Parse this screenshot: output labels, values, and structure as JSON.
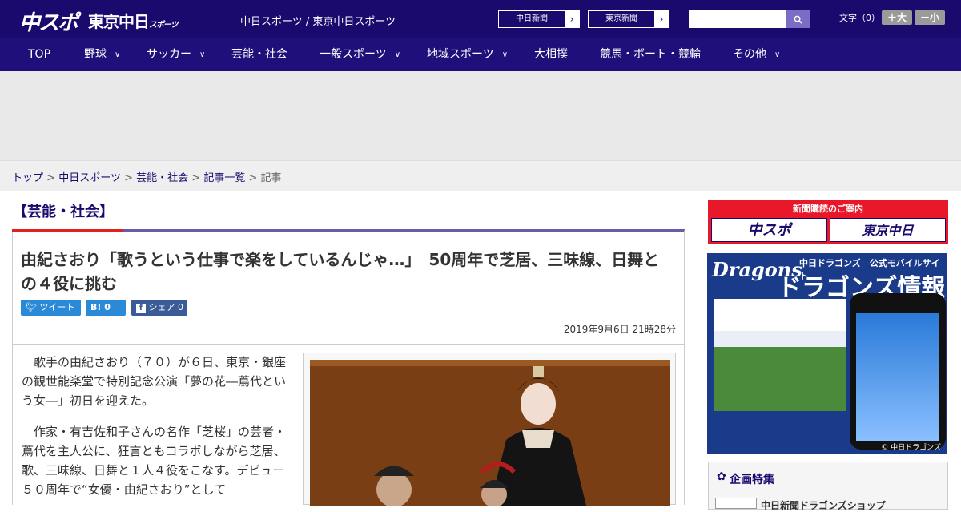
{
  "header": {
    "logo_chuspo": "中スポ",
    "logo_tokyo": "東京中日",
    "logo_tokyo_sub": "スポーツ",
    "site_links": "中日スポーツ / 東京中日スポーツ",
    "btn_chunichi": "中日新聞",
    "btn_tokyo": "東京新聞",
    "search_placeholder": "",
    "fontsize_label": "文字（0）",
    "fs_large": "＋大",
    "fs_small": "－小"
  },
  "nav": [
    {
      "label": "TOP",
      "dropdown": false
    },
    {
      "label": "野球",
      "dropdown": true
    },
    {
      "label": "サッカー",
      "dropdown": true
    },
    {
      "label": "芸能・社会",
      "dropdown": false
    },
    {
      "label": "一般スポーツ",
      "dropdown": true
    },
    {
      "label": "地域スポーツ",
      "dropdown": true
    },
    {
      "label": "大相撲",
      "dropdown": false
    },
    {
      "label": "競馬・ボート・競輪",
      "dropdown": false
    },
    {
      "label": "その他",
      "dropdown": true
    }
  ],
  "breadcrumbs": {
    "home": "トップ",
    "site": "中日スポーツ",
    "category": "芸能・社会",
    "list": "記事一覧",
    "current": "記事",
    "sep": ">"
  },
  "article": {
    "category": "【芸能・社会】",
    "headline": "由紀さおり「歌うという仕事で楽をしているんじゃ…」　50周年で芝居、三味線、日舞との４役に挑む",
    "share_tweet": "ツイート",
    "share_hatena": "B! 0",
    "share_fb": "シェア 0",
    "date": "2019年9月6日 21時28分",
    "paragraphs": [
      "　歌手の由紀さおり（７０）が６日、東京・銀座の観世能楽堂で特別記念公演「夢の花―蔦代という女―」初日を迎えた。",
      "　作家・有吉佐和子さんの名作「芝桜」の芸者・蔦代を主人公に、狂言ともコラボしながら芝居、歌、三味線、日舞と１人４役をこなす。デビュー５０周年で“女優・由紀さおり”として"
    ]
  },
  "sidebar": {
    "subscribe_title": "新聞購読のご案内",
    "subscribe_logo1": "中スポ",
    "subscribe_logo2": "東京中日",
    "dragons_logo": "Dragons",
    "dragons_sub": "中日ドラゴンズ　公式モバイルサイト",
    "dragons_title": "ドラゴンズ情報",
    "dragons_copy": "© 中日ドラゴンズ",
    "feature_title": "企画特集",
    "feature_item": "中日新聞ドラゴンズショップ"
  },
  "colors": {
    "header_bg": "#1a0a6e",
    "accent_red": "#e0221e",
    "accent_purple": "#6b5aa8"
  }
}
